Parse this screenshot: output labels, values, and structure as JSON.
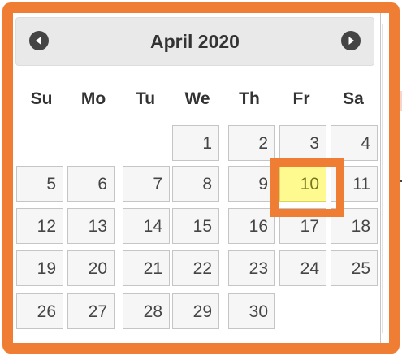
{
  "datepicker": {
    "title": "April 2020",
    "prev_icon": "circle-triangle-west-icon",
    "next_icon": "circle-triangle-east-icon",
    "weekdays": [
      "Su",
      "Mo",
      "Tu",
      "We",
      "Th",
      "Fr",
      "Sa"
    ],
    "weeks": [
      [
        "",
        "",
        "",
        "1",
        "2",
        "3",
        "4"
      ],
      [
        "5",
        "6",
        "7",
        "8",
        "9",
        "10",
        "11"
      ],
      [
        "12",
        "13",
        "14",
        "15",
        "16",
        "17",
        "18"
      ],
      [
        "19",
        "20",
        "21",
        "22",
        "23",
        "24",
        "25"
      ],
      [
        "26",
        "27",
        "28",
        "29",
        "30",
        "",
        ""
      ]
    ],
    "highlighted_day": "10"
  },
  "colors": {
    "annotation": "#ef7d33",
    "highlight_bg": "#fffa90",
    "header_bg": "#e9e9e9",
    "cell_bg": "#f6f6f6"
  }
}
